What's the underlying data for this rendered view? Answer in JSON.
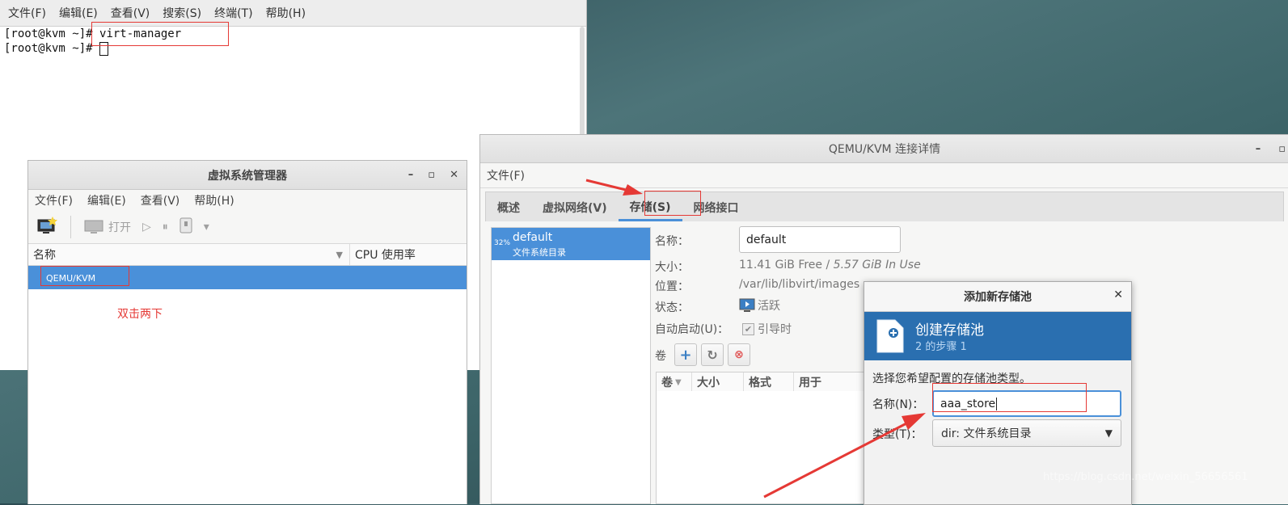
{
  "terminal": {
    "menu": [
      "文件(F)",
      "编辑(E)",
      "查看(V)",
      "搜索(S)",
      "终端(T)",
      "帮助(H)"
    ],
    "line1_prompt": "[root@kvm ~]#",
    "line1_cmd": "virt-manager",
    "line2_prompt": "[root@kvm ~]#"
  },
  "virt_manager": {
    "title": "虚拟系统管理器",
    "menu": [
      "文件(F)",
      "编辑(E)",
      "查看(V)",
      "帮助(H)"
    ],
    "toolbar": {
      "open_label": "打开"
    },
    "columns": {
      "name": "名称",
      "cpu": "CPU 使用率"
    },
    "row": "QEMU/KVM",
    "annotation": "双击两下"
  },
  "conn_details": {
    "title": "QEMU/KVM 连接详情",
    "menu_file": "文件(F)",
    "tabs": [
      "概述",
      "虚拟网络(V)",
      "存储(S)",
      "网络接口"
    ],
    "active_tab": 2,
    "pool": {
      "pct": "32%",
      "name": "default",
      "type": "文件系统目录"
    },
    "fields": {
      "name_label": "名称：",
      "name_value": "default",
      "size_label": "大小：",
      "size_free": "11.41 GiB Free / ",
      "size_used": "5.57 GiB In Use",
      "location_label": "位置：",
      "location_value": "/var/lib/libvirt/images",
      "state_label": "状态：",
      "state_value": "活跃",
      "autostart_label": "自动启动(U)：",
      "autostart_value": "引导时",
      "volumes_label": "卷"
    },
    "vol_columns": [
      "卷",
      "大小",
      "格式",
      "用于"
    ]
  },
  "add_pool_dialog": {
    "title": "添加新存储池",
    "heading": "创建存储池",
    "step": "2 的步骤 1",
    "instruction": "选择您希望配置的存储池类型。",
    "name_label": "名称(N)：",
    "name_value": "aaa_store",
    "type_label": "类型(T)：",
    "type_value": "dir: 文件系统目录"
  },
  "watermark": "https://blog.csdn.net/weixin_56656561",
  "colors": {
    "selection": "#4a90d9",
    "banner": "#2a6fb0",
    "annotation_red": "#e53935"
  }
}
